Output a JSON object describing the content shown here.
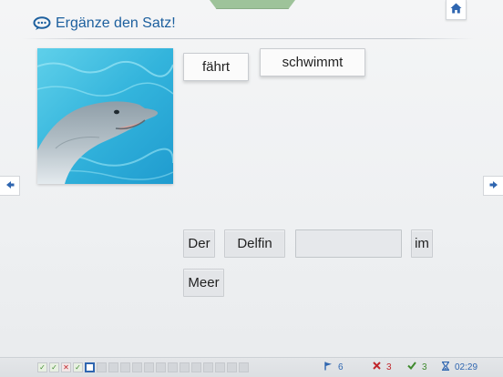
{
  "header": {
    "title": "Ergänze den Satz!",
    "title_icon": "speech-bubble-icon",
    "home_icon": "home-icon"
  },
  "image": {
    "subject": "dolphin-photo"
  },
  "word_bank": [
    "fährt",
    "schwimmt"
  ],
  "sentence": {
    "words_before_gap": [
      "Der",
      "Delfin"
    ],
    "gap_value": "",
    "words_after_gap": [
      "im",
      "Meer"
    ]
  },
  "navigation": {
    "prev_icon": "arrow-left-icon",
    "next_icon": "arrow-right-icon"
  },
  "footer": {
    "progress": [
      "correct",
      "correct",
      "wrong",
      "correct",
      "current",
      "empty",
      "empty",
      "empty",
      "empty",
      "empty",
      "empty",
      "empty",
      "empty",
      "empty",
      "empty",
      "empty",
      "empty",
      "empty"
    ],
    "flag_count": "6",
    "wrong_count": "3",
    "correct_count": "3",
    "time": "02:29"
  },
  "colors": {
    "accent_blue": "#2f66b0",
    "title_blue": "#1c5f9e",
    "correct_green": "#3f8a2e",
    "wrong_red": "#c0262c",
    "tab_green": "#9ec39a"
  }
}
